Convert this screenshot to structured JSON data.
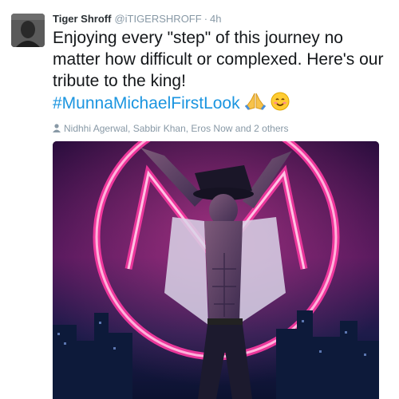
{
  "tweet": {
    "author_name": "Tiger Shroff",
    "handle": "@iTIGERSHROFF",
    "separator": "·",
    "timestamp": "4h",
    "text_line": "Enjoying every \"step\" of this journey no matter how difficult or complexed. Here's our tribute to the king!",
    "hashtag": "#MunnaMichaelFirstLook",
    "emojis": [
      "folded-hands-emoji",
      "smiling-face-emoji"
    ],
    "tagged_users": "Nidhhi Agerwal, Sabbir Khan, Eros Now and 2 others"
  },
  "media": {
    "description_icon": "poster-image",
    "neon_color": "#ff2f9a"
  }
}
